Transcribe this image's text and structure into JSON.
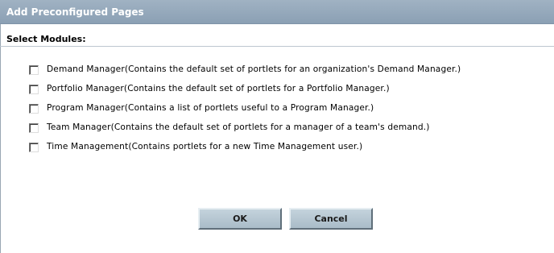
{
  "dialog": {
    "title": "Add Preconfigured Pages",
    "section_label": "Select Modules:",
    "modules": [
      {
        "label": "Demand Manager(Contains the default set of portlets for an organization's Demand Manager.)",
        "checked": false
      },
      {
        "label": "Portfolio Manager(Contains the default set of portlets for a Portfolio Manager.)",
        "checked": false
      },
      {
        "label": "Program Manager(Contains a list of portlets useful to a Program Manager.)",
        "checked": false
      },
      {
        "label": "Team Manager(Contains the default set of portlets for a manager of a team's demand.)",
        "checked": false
      },
      {
        "label": "Time Management(Contains portlets for a new Time Management user.)",
        "checked": false
      }
    ],
    "ok_label": "OK",
    "cancel_label": "Cancel"
  },
  "colors": {
    "title_bar": "#8ba0b4",
    "button": "#b6c7d2"
  }
}
